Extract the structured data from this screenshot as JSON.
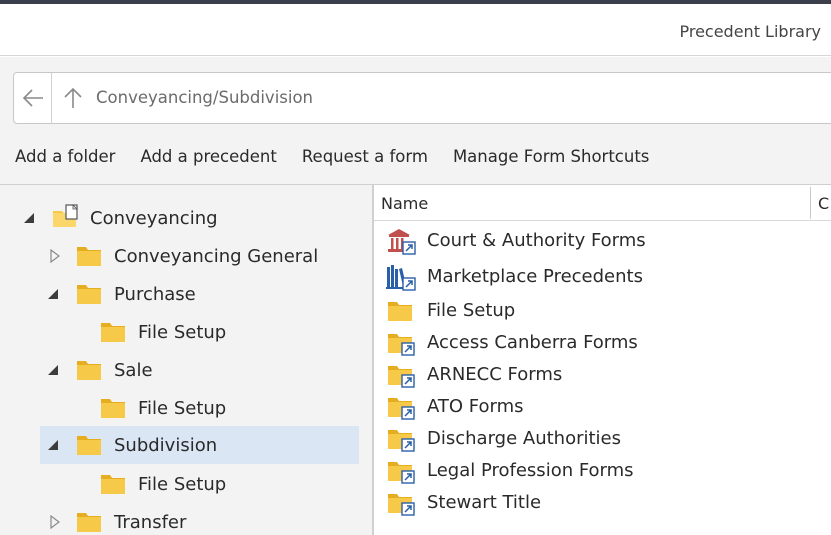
{
  "window": {
    "title": "Precedent Library"
  },
  "address": {
    "path": "Conveyancing/Subdivision"
  },
  "actions": [
    {
      "label": "Add a folder"
    },
    {
      "label": "Add a precedent"
    },
    {
      "label": "Request a form"
    },
    {
      "label": "Manage Form Shortcuts"
    }
  ],
  "tree": {
    "items": [
      {
        "label": "Conveyancing",
        "expander": "expanded",
        "icon": "folder-document-icon"
      },
      {
        "label": "Conveyancing General",
        "expander": "collapsed",
        "icon": "folder-icon"
      },
      {
        "label": "Purchase",
        "expander": "expanded",
        "icon": "folder-icon"
      },
      {
        "label": "File Setup",
        "expander": "none",
        "icon": "folder-icon"
      },
      {
        "label": "Sale",
        "expander": "expanded",
        "icon": "folder-icon"
      },
      {
        "label": "File Setup",
        "expander": "none",
        "icon": "folder-icon"
      },
      {
        "label": "Subdivision",
        "expander": "expanded",
        "icon": "folder-icon",
        "selected": true
      },
      {
        "label": "File Setup",
        "expander": "none",
        "icon": "folder-icon"
      },
      {
        "label": "Transfer",
        "expander": "collapsed",
        "icon": "folder-icon"
      }
    ]
  },
  "list": {
    "columns": {
      "name": "Name",
      "second": "C"
    },
    "rows": [
      {
        "label": "Court & Authority Forms",
        "icon": "courthouse-shortcut-icon"
      },
      {
        "label": "Marketplace Precedents",
        "icon": "library-books-shortcut-icon"
      },
      {
        "label": "File Setup",
        "icon": "folder-icon"
      },
      {
        "label": "Access Canberra Forms",
        "icon": "folder-shortcut-icon"
      },
      {
        "label": "ARNECC Forms",
        "icon": "folder-shortcut-icon"
      },
      {
        "label": "ATO Forms",
        "icon": "folder-shortcut-icon"
      },
      {
        "label": "Discharge Authorities",
        "icon": "folder-shortcut-icon"
      },
      {
        "label": "Legal Profession Forms",
        "icon": "folder-shortcut-icon"
      },
      {
        "label": "Stewart Title",
        "icon": "folder-shortcut-icon"
      }
    ]
  },
  "colors": {
    "folder": "#f7c948",
    "folder_dark": "#e6ad1f",
    "shortcut_blue": "#2b5fa8",
    "selection": "#dbe6f4",
    "courthouse": "#c0504d"
  }
}
